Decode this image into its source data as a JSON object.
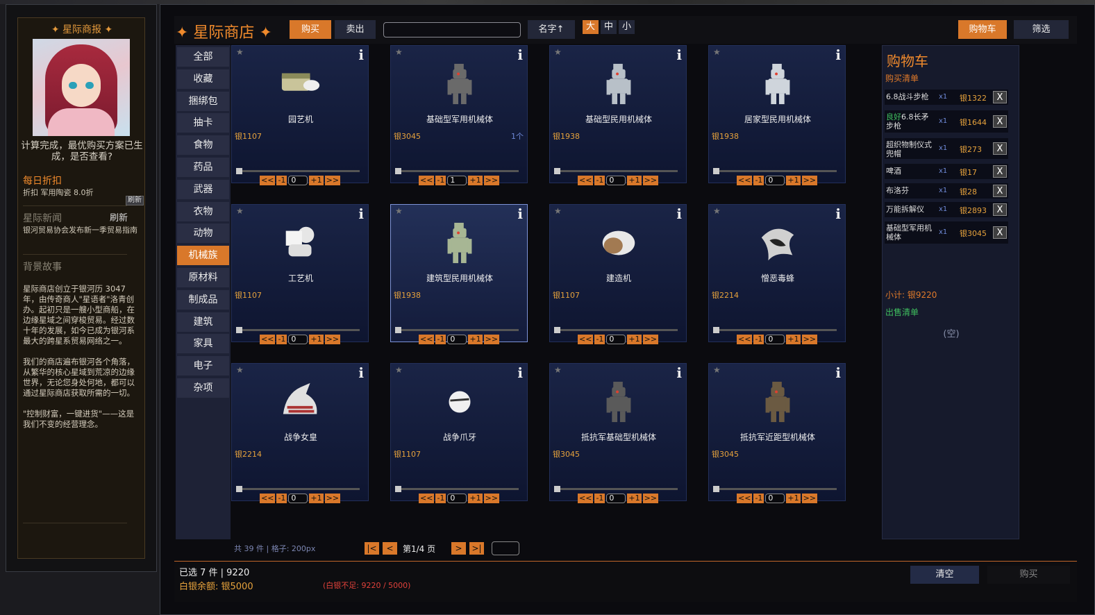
{
  "left": {
    "title": "✦ 星际商报 ✦",
    "message": "计算完成，最优购买方案已生成，是否查看?",
    "daily_heading": "每日折扣",
    "daily_text": "折扣 军用陶瓷 8.0折",
    "refresh_small": "刷新",
    "news_heading": "星际新闻",
    "news_refresh": "刷新",
    "news_text": "银河贸易协会发布新一季贸易指南",
    "story_heading": "背景故事",
    "story_text": "星际商店创立于银河历 3047 年，由传奇商人\"星语者\"洛青创办。起初只是一艘小型商船，在边缘星域之间穿梭贸易。经过数十年的发展，如今已成为银河系最大的跨星系贸易网络之一。\n\n我们的商店遍布银河各个角落，从繁华的核心星域到荒凉的边缘世界，无论您身处何地，都可以通过星际商店获取所需的一切。\n\n\"控制财富，一键进货\"——这是我们不变的经营理念。"
  },
  "header": {
    "title": "✦ 星际商店 ✦",
    "buy_tab": "购买",
    "sell_tab": "卖出",
    "search_placeholder": "",
    "sort_label": "名字↑",
    "size_large": "大",
    "size_medium": "中",
    "size_small": "小",
    "cart_button": "购物车",
    "filter_button": "筛选"
  },
  "categories": [
    "全部",
    "收藏",
    "捆绑包",
    "抽卡",
    "食物",
    "药品",
    "武器",
    "衣物",
    "动物",
    "机械族",
    "原材料",
    "制成品",
    "建筑",
    "家具",
    "电子",
    "杂项"
  ],
  "active_category": "机械族",
  "items": [
    {
      "name": "园艺机",
      "price": "银1107",
      "qty_text": "",
      "input": "0",
      "icon": "gardener-mech-icon",
      "color": "#c9c49a"
    },
    {
      "name": "基础型军用机械体",
      "price": "银3045",
      "qty_text": "1个",
      "input": "1",
      "icon": "military-mechanoid-icon",
      "color": "#6a6a6a"
    },
    {
      "name": "基础型民用机械体",
      "price": "银1938",
      "qty_text": "",
      "input": "0",
      "icon": "civil-mechanoid-icon",
      "color": "#b8c0c8"
    },
    {
      "name": "居家型民用机械体",
      "price": "银1938",
      "qty_text": "",
      "input": "0",
      "icon": "house-mechanoid-icon",
      "color": "#cfd5dc"
    },
    {
      "name": "工艺机",
      "price": "银1107",
      "qty_text": "",
      "input": "0",
      "icon": "fabricor-mech-icon",
      "color": "#e6e6e6"
    },
    {
      "name": "建筑型民用机械体",
      "price": "银1938",
      "qty_text": "",
      "input": "0",
      "icon": "builder-mechanoid-icon",
      "color": "#a7b694"
    },
    {
      "name": "建造机",
      "price": "银1107",
      "qty_text": "",
      "input": "0",
      "icon": "constructoid-icon",
      "color": "#e8e8e8"
    },
    {
      "name": "憎恶毒蜂",
      "price": "银2214",
      "qty_text": "",
      "input": "0",
      "icon": "wasp-icon",
      "color": "#d0d0d0"
    },
    {
      "name": "战争女皇",
      "price": "银2214",
      "qty_text": "",
      "input": "0",
      "icon": "war-queen-icon",
      "color": "#e0e0e0"
    },
    {
      "name": "战争爪牙",
      "price": "银1107",
      "qty_text": "",
      "input": "0",
      "icon": "war-urchin-icon",
      "color": "#f0f0f0"
    },
    {
      "name": "抵抗军基础型机械体",
      "price": "银3045",
      "qty_text": "",
      "input": "0",
      "icon": "resistance-mechanoid-icon",
      "color": "#5a5a5a"
    },
    {
      "name": "抵抗军近距型机械体",
      "price": "银3045",
      "qty_text": "",
      "input": "0",
      "icon": "resistance-melee-mechanoid-icon",
      "color": "#6b5a42"
    }
  ],
  "pager": {
    "info": "共 39 件 | 格子: 200px",
    "first": "|<",
    "prev": "<",
    "page_text": "第1/4 页",
    "next": ">",
    "last": ">|",
    "goto_value": ""
  },
  "cart": {
    "title": "购物车",
    "buy_list": "购买清单",
    "rows": [
      {
        "name": "6.8战斗步枪",
        "prefix": "",
        "qty": "x1",
        "price": "银1322"
      },
      {
        "name": "6.8长矛步枪",
        "prefix": "良好",
        "qty": "x1",
        "price": "银1644"
      },
      {
        "name": "超织物制仪式兜帽",
        "prefix": "",
        "qty": "x1",
        "price": "银273"
      },
      {
        "name": "啤酒",
        "prefix": "",
        "qty": "x1",
        "price": "银17"
      },
      {
        "name": "布洛芬",
        "prefix": "",
        "qty": "x1",
        "price": "银28"
      },
      {
        "name": "万能拆解仪",
        "prefix": "",
        "qty": "x1",
        "price": "银2893"
      },
      {
        "name": "基础型军用机械体",
        "prefix": "",
        "qty": "x1",
        "price": "银3045"
      }
    ],
    "delete_label": "X",
    "subtotal": "小计: 银9220",
    "sell_list": "出售清单",
    "empty": "(空)"
  },
  "footer": {
    "selected": "已选 7 件 | 9220",
    "balance": "白银余额: 银5000",
    "warning": "(白银不足: 9220 / 5000)",
    "clear": "清空",
    "buy": "购买"
  },
  "colors": {
    "accent": "#d9782a",
    "gold": "#e6a23c",
    "green": "#3fbf5f"
  }
}
